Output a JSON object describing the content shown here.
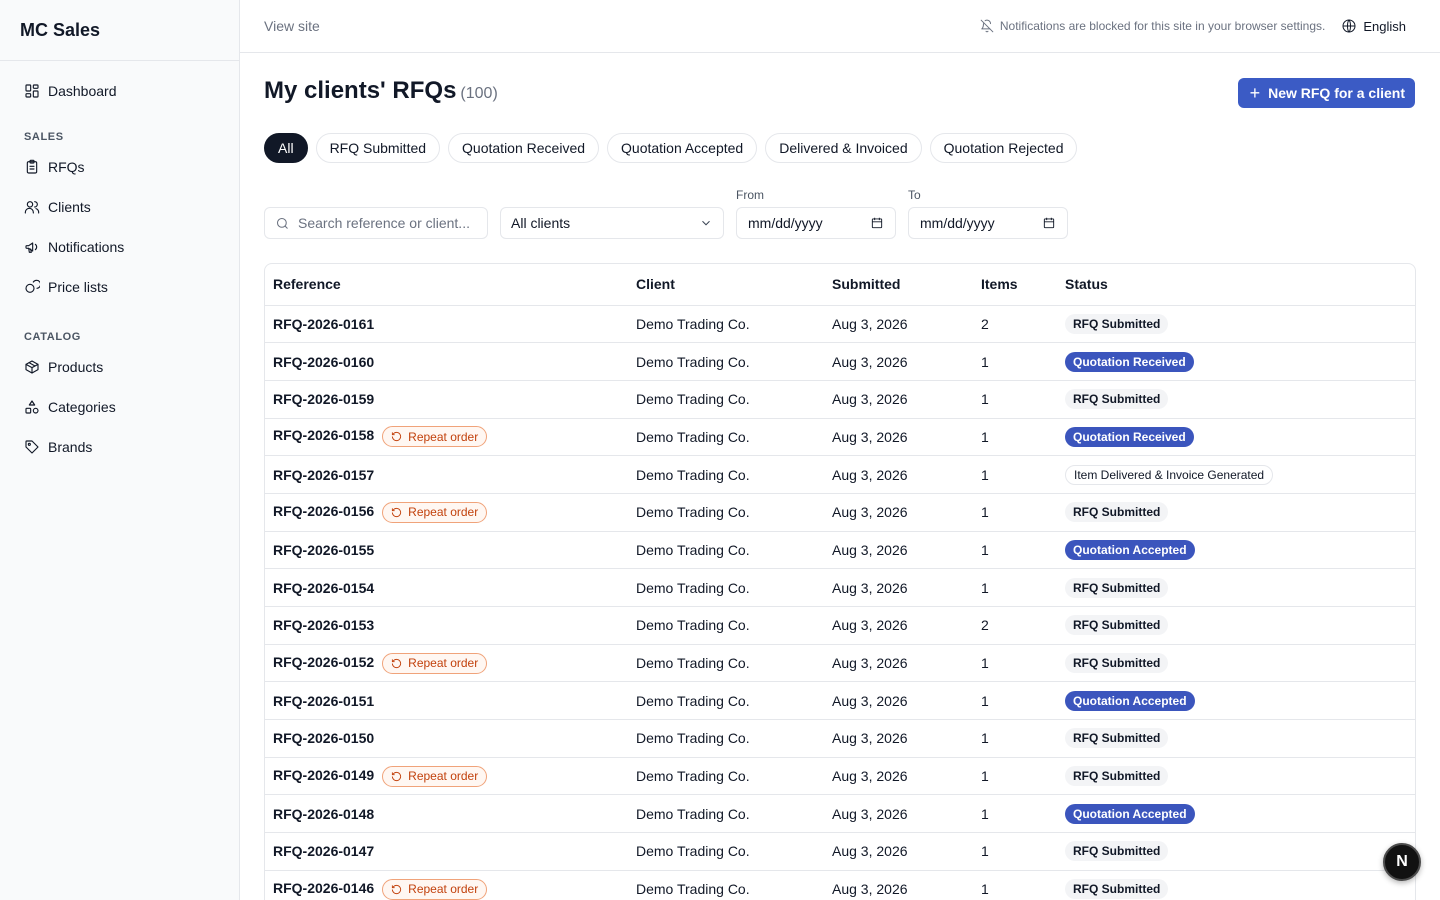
{
  "app": {
    "brand": "MC Sales"
  },
  "sidebar": {
    "dashboard": "Dashboard",
    "sales_section": "SALES",
    "rfqs": "RFQs",
    "clients": "Clients",
    "notifications": "Notifications",
    "price_lists": "Price lists",
    "catalog_section": "CATALOG",
    "products": "Products",
    "categories": "Categories",
    "brands": "Brands"
  },
  "topbar": {
    "view_site": "View site",
    "notification_notice": "Notifications are blocked for this site in your browser settings.",
    "language": "English"
  },
  "page": {
    "title": "My clients' RFQs",
    "count": "(100)",
    "new_button": "New RFQ for a client"
  },
  "tabs": [
    "All",
    "RFQ Submitted",
    "Quotation Received",
    "Quotation Accepted",
    "Delivered & Invoiced",
    "Quotation Rejected"
  ],
  "filters": {
    "search_placeholder": "Search reference or client...",
    "client_select": "All clients",
    "from_label": "From",
    "to_label": "To",
    "from_value": "mm/dd/yyyy",
    "to_value": "mm/dd/yyyy"
  },
  "table": {
    "headers": [
      "Reference",
      "Client",
      "Submitted",
      "Items",
      "Status"
    ],
    "repeat_label": "Repeat order",
    "rows": [
      {
        "ref": "RFQ-2026-0161",
        "repeat": false,
        "client": "Demo Trading Co.",
        "submitted": "Aug 3, 2026",
        "items": "2",
        "status": "RFQ Submitted",
        "status_type": "rfq"
      },
      {
        "ref": "RFQ-2026-0160",
        "repeat": false,
        "client": "Demo Trading Co.",
        "submitted": "Aug 3, 2026",
        "items": "1",
        "status": "Quotation Received",
        "status_type": "qr"
      },
      {
        "ref": "RFQ-2026-0159",
        "repeat": false,
        "client": "Demo Trading Co.",
        "submitted": "Aug 3, 2026",
        "items": "1",
        "status": "RFQ Submitted",
        "status_type": "rfq"
      },
      {
        "ref": "RFQ-2026-0158",
        "repeat": true,
        "client": "Demo Trading Co.",
        "submitted": "Aug 3, 2026",
        "items": "1",
        "status": "Quotation Received",
        "status_type": "qr"
      },
      {
        "ref": "RFQ-2026-0157",
        "repeat": false,
        "client": "Demo Trading Co.",
        "submitted": "Aug 3, 2026",
        "items": "1",
        "status": "Item Delivered & Invoice Generated",
        "status_type": "del"
      },
      {
        "ref": "RFQ-2026-0156",
        "repeat": true,
        "client": "Demo Trading Co.",
        "submitted": "Aug 3, 2026",
        "items": "1",
        "status": "RFQ Submitted",
        "status_type": "rfq"
      },
      {
        "ref": "RFQ-2026-0155",
        "repeat": false,
        "client": "Demo Trading Co.",
        "submitted": "Aug 3, 2026",
        "items": "1",
        "status": "Quotation Accepted",
        "status_type": "qa"
      },
      {
        "ref": "RFQ-2026-0154",
        "repeat": false,
        "client": "Demo Trading Co.",
        "submitted": "Aug 3, 2026",
        "items": "1",
        "status": "RFQ Submitted",
        "status_type": "rfq"
      },
      {
        "ref": "RFQ-2026-0153",
        "repeat": false,
        "client": "Demo Trading Co.",
        "submitted": "Aug 3, 2026",
        "items": "2",
        "status": "RFQ Submitted",
        "status_type": "rfq"
      },
      {
        "ref": "RFQ-2026-0152",
        "repeat": true,
        "client": "Demo Trading Co.",
        "submitted": "Aug 3, 2026",
        "items": "1",
        "status": "RFQ Submitted",
        "status_type": "rfq"
      },
      {
        "ref": "RFQ-2026-0151",
        "repeat": false,
        "client": "Demo Trading Co.",
        "submitted": "Aug 3, 2026",
        "items": "1",
        "status": "Quotation Accepted",
        "status_type": "qa"
      },
      {
        "ref": "RFQ-2026-0150",
        "repeat": false,
        "client": "Demo Trading Co.",
        "submitted": "Aug 3, 2026",
        "items": "1",
        "status": "RFQ Submitted",
        "status_type": "rfq"
      },
      {
        "ref": "RFQ-2026-0149",
        "repeat": true,
        "client": "Demo Trading Co.",
        "submitted": "Aug 3, 2026",
        "items": "1",
        "status": "RFQ Submitted",
        "status_type": "rfq"
      },
      {
        "ref": "RFQ-2026-0148",
        "repeat": false,
        "client": "Demo Trading Co.",
        "submitted": "Aug 3, 2026",
        "items": "1",
        "status": "Quotation Accepted",
        "status_type": "qa"
      },
      {
        "ref": "RFQ-2026-0147",
        "repeat": false,
        "client": "Demo Trading Co.",
        "submitted": "Aug 3, 2026",
        "items": "1",
        "status": "RFQ Submitted",
        "status_type": "rfq"
      },
      {
        "ref": "RFQ-2026-0146",
        "repeat": true,
        "client": "Demo Trading Co.",
        "submitted": "Aug 3, 2026",
        "items": "1",
        "status": "RFQ Submitted",
        "status_type": "rfq"
      }
    ]
  },
  "fab": {
    "label": "N"
  },
  "colors": {
    "primary": "#3b5bc5",
    "repeat_accent": "#c2410c",
    "active_tab": "#111827"
  }
}
